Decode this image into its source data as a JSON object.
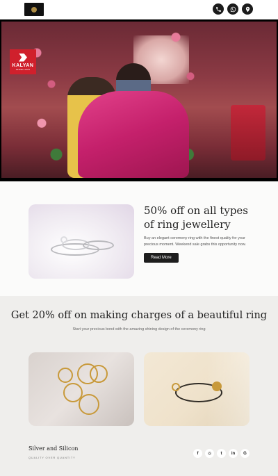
{
  "header": {
    "logo_icon": "brand-crest-logo",
    "actions": [
      {
        "icon": "phone-icon"
      },
      {
        "icon": "whatsapp-icon"
      },
      {
        "icon": "location-pin-icon"
      }
    ]
  },
  "hero": {
    "badge": {
      "brand": "KALYAN",
      "tagline": "JEWELLERS"
    }
  },
  "offer": {
    "title": "50% off on all types of ring jewellery",
    "description": "Buy an elegant ceremony ring with the finest quality for your precious moment. Weekend sale grabs this opportunity now.",
    "button_label": "Read More"
  },
  "promo": {
    "title": "Get 20% off on making charges of a beautiful ring",
    "subtitle": "Start your precious bond with the amazing shining design of the ceremony ring"
  },
  "footer": {
    "brand_name": "Silver and Silicon",
    "tagline": "QUALITY OVER QUANTITY",
    "socials": [
      {
        "icon": "facebook-icon",
        "glyph": "f"
      },
      {
        "icon": "instagram-icon",
        "glyph": "◎"
      },
      {
        "icon": "twitter-icon",
        "glyph": "t"
      },
      {
        "icon": "linkedin-icon",
        "glyph": "in"
      },
      {
        "icon": "google-icon",
        "glyph": "G"
      }
    ]
  },
  "colors": {
    "accent_dark": "#1d1d1d",
    "brand_red": "#d0202c"
  }
}
